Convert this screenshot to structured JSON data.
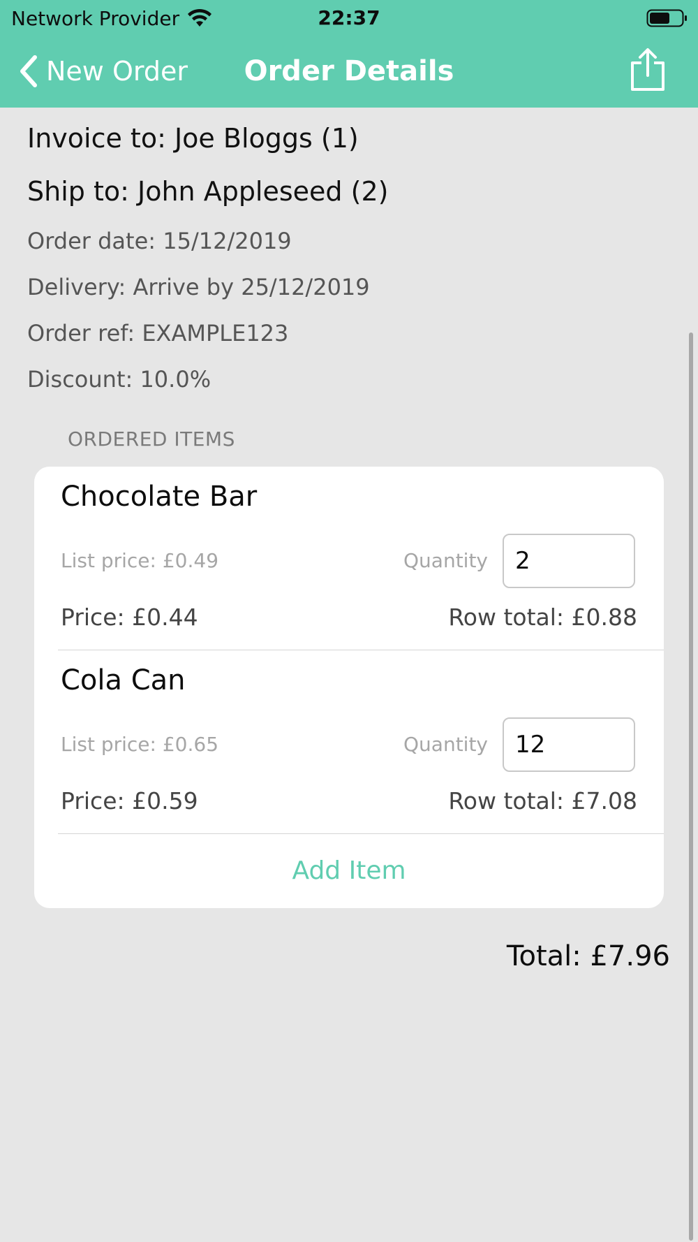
{
  "status_bar": {
    "carrier": "Network Provider",
    "time": "22:37"
  },
  "nav": {
    "back_label": "New Order",
    "title": "Order Details",
    "icons": [
      "chevron-left-icon",
      "share-icon",
      "wifi-icon",
      "battery-icon"
    ]
  },
  "order": {
    "invoice_to": "Invoice to: Joe Bloggs (1)",
    "ship_to": "Ship to: John Appleseed (2)",
    "order_date": "Order date: 15/12/2019",
    "delivery": "Delivery: Arrive by 25/12/2019",
    "order_ref": "Order ref: EXAMPLE123",
    "discount": "Discount: 10.0%"
  },
  "items_section": {
    "header": "ORDERED ITEMS",
    "items": [
      {
        "name": "Chocolate Bar",
        "list_price": "List price: £0.49",
        "quantity_label": "Quantity",
        "quantity": "2",
        "price": "Price: £0.44",
        "row_total": "Row total: £0.88"
      },
      {
        "name": "Cola Can",
        "list_price": "List price: £0.65",
        "quantity_label": "Quantity",
        "quantity": "12",
        "price": "Price: £0.59",
        "row_total": "Row total: £7.08"
      }
    ],
    "add_item_label": "Add Item"
  },
  "total": "Total: £7.96",
  "colors": {
    "accent": "#60cdb0",
    "background": "#e6e6e6"
  }
}
